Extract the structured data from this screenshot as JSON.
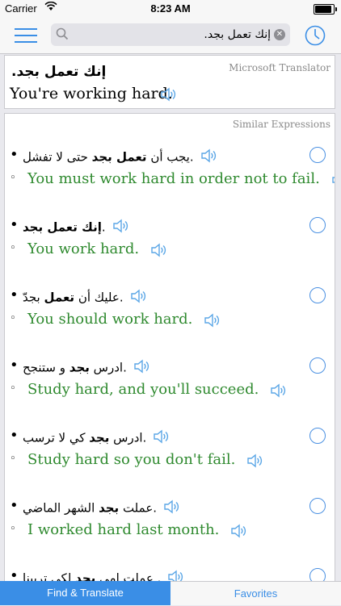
{
  "status_bar": {
    "carrier": "Carrier",
    "time": "8:23 AM",
    "battery_level": 1.0
  },
  "navbar": {
    "search_value": "إنك تعمل بجد.",
    "icons": {
      "menu": "hamburger-icon",
      "search": "magnifier-icon",
      "clear": "clear-icon",
      "history": "clock-icon"
    }
  },
  "main_translation": {
    "provider": "Microsoft Translator",
    "source": ".إنك تعمل بجد",
    "translation": "You're working hard."
  },
  "similar": {
    "title": "Similar Expressions",
    "items": [
      {
        "ar_pre": "يجب أن ",
        "ar_bold": "تعمل بجد",
        "ar_post": " حتى لا تفشل.",
        "en": "You must work hard in order not to fail."
      },
      {
        "ar_pre": "",
        "ar_bold": "إنك تعمل بجد",
        "ar_post": ".",
        "en": "You work hard."
      },
      {
        "ar_pre": "عليك أن ",
        "ar_bold": "تعمل",
        "ar_post": " بجدّ.",
        "en": "You should work hard."
      },
      {
        "ar_pre": "ادرس ",
        "ar_bold": "بجد",
        "ar_post": " و ستنجح.",
        "en": "Study hard, and you'll succeed."
      },
      {
        "ar_pre": "ادرس ",
        "ar_bold": "بجد",
        "ar_post": " كي لا ترسب.",
        "en": "Study hard so you don't fail."
      },
      {
        "ar_pre": "عملت ",
        "ar_bold": "بجد",
        "ar_post": " الشهر الماضي.",
        "en": "I worked hard last month."
      },
      {
        "ar_pre": "عملت امي ",
        "ar_bold": "بجد",
        "ar_post": " لكي تربينا .",
        "en": ""
      }
    ]
  },
  "tabs": {
    "find": "Find & Translate",
    "favorites": "Favorites"
  },
  "colors": {
    "accent": "#3a8ee6",
    "english_green": "#2f8a2f"
  }
}
